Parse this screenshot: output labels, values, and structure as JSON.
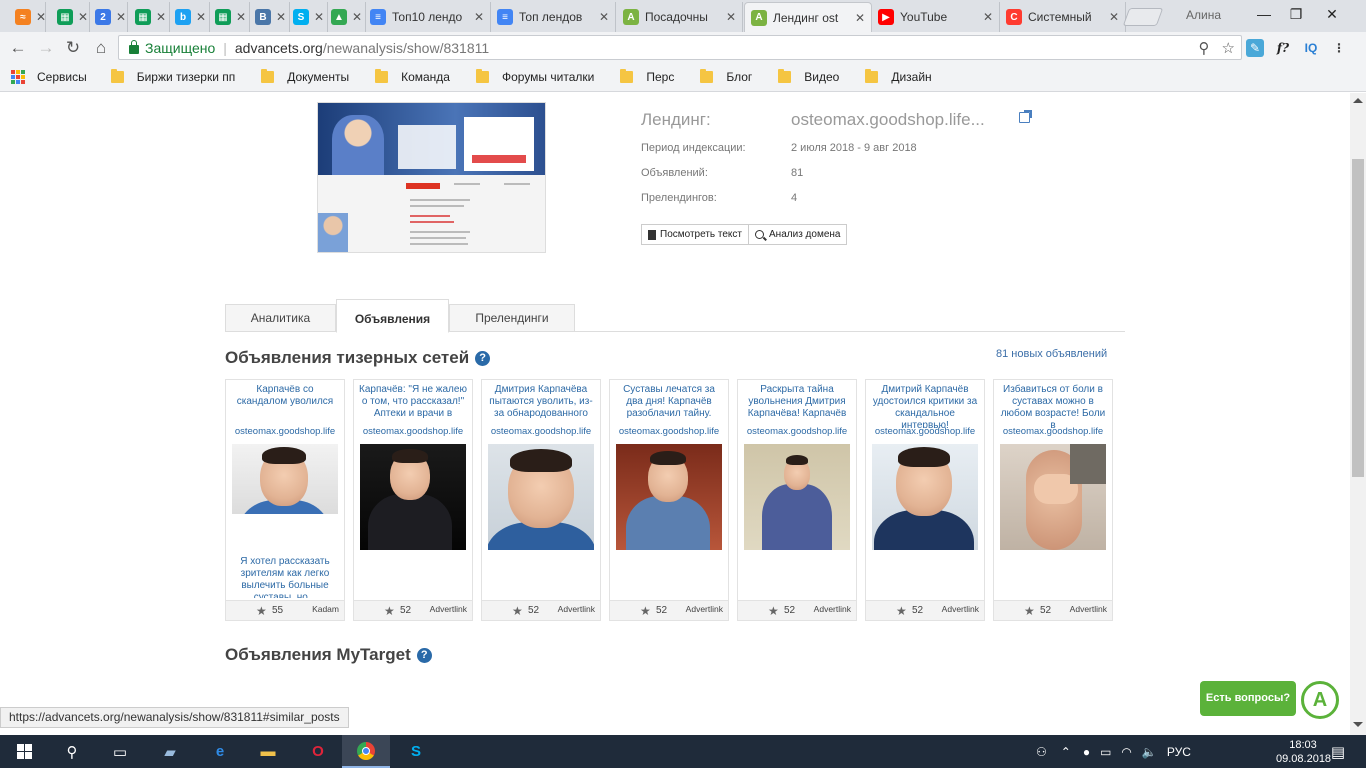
{
  "browser": {
    "tabs": [
      {
        "title": "",
        "color": "#f48120",
        "glyph": "≈"
      },
      {
        "title": "",
        "color": "#0f9d58",
        "glyph": "▦"
      },
      {
        "title": "",
        "color": "#3b78e7",
        "glyph": "2"
      },
      {
        "title": "",
        "color": "#0f9d58",
        "glyph": "▦"
      },
      {
        "title": "",
        "color": "#1da1f2",
        "glyph": "b"
      },
      {
        "title": "",
        "color": "#0f9d58",
        "glyph": "▦"
      },
      {
        "title": "",
        "color": "#4a76a8",
        "glyph": "B"
      },
      {
        "title": "",
        "color": "#00aff0",
        "glyph": "S"
      },
      {
        "title": "",
        "color": "#34a853",
        "glyph": "▲"
      },
      {
        "title": "Топ10 лендо",
        "color": "#4285f4",
        "glyph": "≡"
      },
      {
        "title": "Топ лендов",
        "color": "#4285f4",
        "glyph": "≡"
      },
      {
        "title": "Посадочны",
        "color": "#7cb342",
        "glyph": "A"
      },
      {
        "title": "Лендинг ost",
        "color": "#7cb342",
        "glyph": "A"
      },
      {
        "title": "YouTube",
        "color": "#ff0000",
        "glyph": "▶"
      },
      {
        "title": "Системный",
        "color": "#ff3b30",
        "glyph": "C"
      }
    ],
    "profile_name": "Алина",
    "secure_label": "Защищено",
    "url_domain": "advancets.org",
    "url_path": "/newanalysis/show/831811",
    "bookmarks": {
      "apps_label": "Сервисы",
      "folders": [
        "Биржи тизерки пп",
        "Документы",
        "Команда",
        "Форумы читалки",
        "Перс",
        "Блог",
        "Видео",
        "Дизайн"
      ]
    },
    "status_url": "https://advancets.org/newanalysis/show/831811#similar_posts"
  },
  "landing": {
    "title_label": "Лендинг:",
    "title_value": "osteomax.goodshop.life...",
    "period_label": "Период индексации:",
    "period_value": "2 июля 2018 - 9 авг 2018",
    "ads_label": "Объявлений:",
    "ads_value": "81",
    "prelandings_label": "Прелендингов:",
    "prelandings_value": "4",
    "view_text_button": "Посмотреть текст",
    "domain_analysis_button": "Анализ домена"
  },
  "tabs": {
    "analytics": "Аналитика",
    "ads": "Объявления",
    "prelandings": "Прелендинги"
  },
  "teaser_section": {
    "title": "Объявления тизерных сетей",
    "new_ads_link": "81 новых объявлений",
    "ads": [
      {
        "headline": "Карпачёв со скандалом уволился",
        "domain": "osteomax.goodshop.life",
        "description": "Я хотел рассказать зрителям как легко вылечить больные суставы, но...",
        "count": "55",
        "network": "Kadam"
      },
      {
        "headline": "Карпачёв: \"Я не жалею о том, что рассказал!\" Аптеки и врачи в",
        "domain": "osteomax.goodshop.life",
        "description": "",
        "count": "52",
        "network": "Advertlink"
      },
      {
        "headline": "Дмитрия Карпачёва пытаются уволить, из-за обнародованного",
        "domain": "osteomax.goodshop.life",
        "description": "",
        "count": "52",
        "network": "Advertlink"
      },
      {
        "headline": "Суставы лечатся за два дня! Карпачёв разоблачил тайну.",
        "domain": "osteomax.goodshop.life",
        "description": "",
        "count": "52",
        "network": "Advertlink"
      },
      {
        "headline": "Раскрыта тайна увольнения Дмитрия Карпачёва! Карпачёв",
        "domain": "osteomax.goodshop.life",
        "description": "",
        "count": "52",
        "network": "Advertlink"
      },
      {
        "headline": "Дмитрий Карпачёв удостоился критики за скандальное интервью!",
        "domain": "osteomax.goodshop.life",
        "description": "",
        "count": "52",
        "network": "Advertlink"
      },
      {
        "headline": "Избавиться от боли в суставах можно в любом возрасте! Боли в",
        "domain": "osteomax.goodshop.life",
        "description": "",
        "count": "52",
        "network": "Advertlink"
      }
    ]
  },
  "mytarget_section": {
    "title": "Объявления MyTarget"
  },
  "chat_widget": {
    "label": "Есть вопросы?"
  },
  "taskbar": {
    "language": "РУС",
    "time": "18:03",
    "date": "09.08.2018"
  }
}
